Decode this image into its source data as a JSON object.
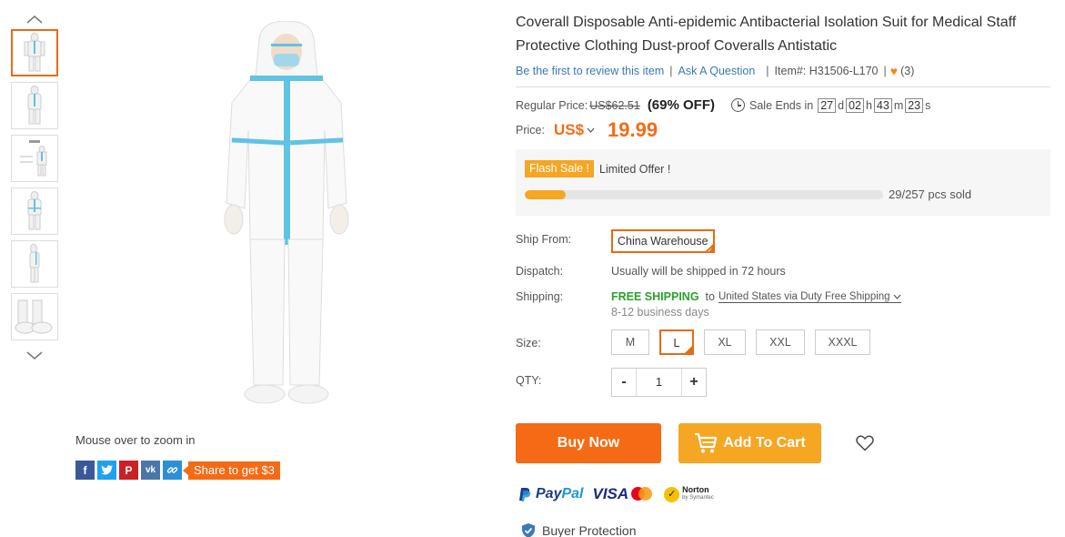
{
  "gallery": {
    "up_icon": "chevron-up-icon",
    "down_icon": "chevron-down-icon",
    "thumbnails": [
      "thumb-front",
      "thumb-front-2",
      "thumb-size-chart",
      "thumb-front-3",
      "thumb-side",
      "thumb-shoe-covers"
    ],
    "zoom_hint": "Mouse over to zoom in",
    "share_label": "Share to get $3",
    "share_icons": [
      "facebook-icon",
      "twitter-icon",
      "pinterest-icon",
      "vk-icon",
      "link-icon"
    ]
  },
  "product": {
    "title": "Coverall Disposable Anti-epidemic Antibacterial Isolation Suit for Medical Staff Protective Clothing Dust-proof Coveralls Antistatic",
    "review_link": "Be the first to review this item",
    "ask_link": "Ask A Question",
    "item_no": "Item#: H31506-L170",
    "fav_count": "(3)"
  },
  "pricing": {
    "regular_label": "Regular Price:",
    "regular_price": "US$62.51",
    "discount": "(69% OFF)",
    "sale_ends_label": "Sale Ends in",
    "days": "27",
    "days_unit": "d",
    "hours": "02",
    "hours_unit": "h",
    "minutes": "43",
    "minutes_unit": "m",
    "seconds": "23",
    "seconds_unit": "s",
    "price_label": "Price:",
    "currency": "US$",
    "price": "19.99"
  },
  "flash": {
    "tag": "Flash Sale !",
    "text": "Limited Offer !",
    "sold_text": "29/257 pcs sold",
    "progress_fraction": 0.113,
    "accent": "#f5a623"
  },
  "options": {
    "ship_from_label": "Ship From:",
    "ship_from_value": "China Warehouse",
    "dispatch_label": "Dispatch:",
    "dispatch_value": "Usually will be shipped in 72 hours",
    "shipping_label": "Shipping:",
    "free_shipping": "FREE SHIPPING",
    "to_text": "to",
    "shipping_dest": "United States via Duty Free Shipping",
    "shipping_time": "8-12 business days",
    "size_label": "Size:",
    "sizes": [
      "M",
      "L",
      "XL",
      "XXL",
      "XXXL"
    ],
    "selected_size": "L",
    "qty_label": "QTY:",
    "qty_minus": "-",
    "qty_value": "1",
    "qty_plus": "+"
  },
  "actions": {
    "buy_now": "Buy Now",
    "add_to_cart": "Add To Cart",
    "primary_color": "#f56b15",
    "secondary_color": "#f5a623"
  },
  "payments": {
    "paypal_part1": "Pay",
    "paypal_part2": "Pal",
    "visa": "VISA",
    "norton_top": "Norton",
    "norton_bottom": "by Symantec"
  },
  "buyer_protection": "Buyer Protection"
}
